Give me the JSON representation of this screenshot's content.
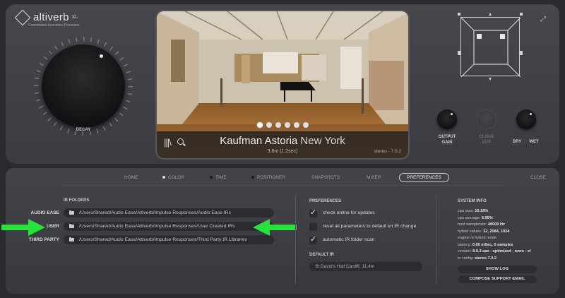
{
  "app": {
    "name": "altiverb",
    "edition": "XL",
    "subtitle": "Convolution Acoustics Processor"
  },
  "decay": {
    "label": "DECAY"
  },
  "ir_display": {
    "venue_bold": "Kaufman Astoria",
    "venue_city": "New York",
    "details": "3.8m (1.2sec)",
    "version": "stereo - 7.0.2",
    "photo_count": 6,
    "active_photo": 0
  },
  "knobs": {
    "output_gain": "OUTPUT\nGAIN",
    "cloud_size": "CLOUD\nSIZE",
    "dry": "DRY",
    "wet": "WET"
  },
  "nav": {
    "home": "HOME",
    "color": "COLOR",
    "time": "TIME",
    "positioner": "POSITIONER",
    "snapshots": "SNAPSHOTS",
    "mixer": "MIXER",
    "preferences": "PREFERENCES",
    "close": "CLOSE"
  },
  "ir_folders": {
    "title": "IR FOLDERS",
    "rows": [
      {
        "label": "AUDIO EASE",
        "path": "/Users/Shared/Audio Ease/Altiverb/Impulse Responses/Audio Ease IRs"
      },
      {
        "label": "USER",
        "path": "/Users/Shared/Audio Ease/Altiverb/Impulse Responses/User Created IRs"
      },
      {
        "label": "THIRD PARTY",
        "path": "/Users/Shared/Audio Ease/Altiverb/Impulse Responses/Third Party IR Libraries"
      }
    ]
  },
  "preferences": {
    "title": "PREFERENCES",
    "options": [
      {
        "label": "check online for updates",
        "checked": true
      },
      {
        "label": "reset all parameters to default on IR change",
        "checked": false
      },
      {
        "label": "automatic IR folder scan",
        "checked": true
      }
    ],
    "default_ir_title": "DEFAULT IR",
    "default_ir_value": "St David's Hall Cardiff, 11.4m"
  },
  "system_info": {
    "title": "SYSTEM INFO",
    "lines": [
      {
        "key": "cpu max:",
        "value": "10.18%"
      },
      {
        "key": "cpu average:",
        "value": "6.95%"
      },
      {
        "key": "host samplerate:",
        "value": "48000 Hz"
      },
      {
        "key": "hybrid values:",
        "value": "32, 2084, 1024"
      },
      {
        "key": "engine in hybrid mode",
        "value": ""
      },
      {
        "key": "latency:",
        "value": "0.00 mSec, 0 samples"
      },
      {
        "key": "version:",
        "value": "8.0.3 aax - optimized - neon - xl"
      },
      {
        "key": "io config:",
        "value": "stereo-7.0.2"
      }
    ],
    "show_log": "SHOW LOG",
    "compose_email": "COMPOSE SUPPORT EMAIL"
  },
  "colors": {
    "arrow": "#27e23a",
    "panel": "#3f4046",
    "field": "#2b2c30"
  }
}
